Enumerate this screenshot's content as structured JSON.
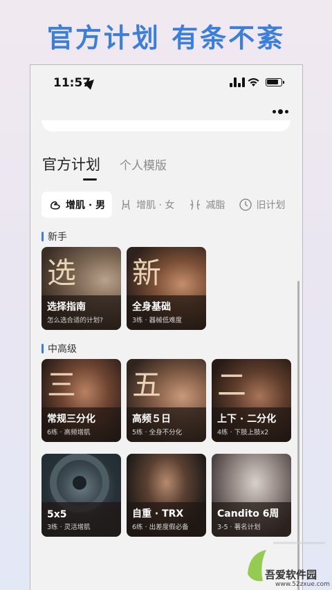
{
  "headline": "官方计划 有条不紊",
  "status": {
    "time": "11:57"
  },
  "tabs": [
    {
      "label": "官方计划",
      "active": true
    },
    {
      "label": "个人模版",
      "active": false
    }
  ],
  "chips": [
    {
      "label": "增肌 · 男",
      "icon": "male-muscle-icon",
      "active": true
    },
    {
      "label": "增肌 · 女",
      "icon": "female-body-icon",
      "active": false
    },
    {
      "label": "减脂",
      "icon": "waist-icon",
      "active": false
    },
    {
      "label": "旧计划",
      "icon": "clock-icon",
      "active": false
    }
  ],
  "sections": {
    "beginner": "新手",
    "advanced": "中高级"
  },
  "cards": {
    "guide": {
      "big": "选",
      "title": "选择指南",
      "sub": "怎么选合适的计划?"
    },
    "fullbody": {
      "big": "新",
      "title": "全身基础",
      "sub": "3练 · 器械低难度"
    },
    "split3": {
      "big": "三",
      "title": "常规三分化",
      "sub": "6练 · 高频增肌"
    },
    "day5": {
      "big": "五",
      "title": "高频５日",
      "sub": "5练 · 全身不分化"
    },
    "split2": {
      "big": "二",
      "title": "上下 · 二分化",
      "sub": "4练 · 下肢上肢x2"
    },
    "fivebyfive": {
      "title": "5x5",
      "sub": "3练 · 灵活增肌"
    },
    "trx": {
      "title": "自重 · TRX",
      "sub": "6练 · 出差度假必备"
    },
    "candito": {
      "title": "Candito 6周",
      "sub": "3-5 · 著名计划"
    }
  },
  "watermark": {
    "title": "吾爱软件园",
    "url": "www.52zxue.com"
  },
  "colors": {
    "accent": "#3a7ee0",
    "card_shade": "#1e1612"
  }
}
